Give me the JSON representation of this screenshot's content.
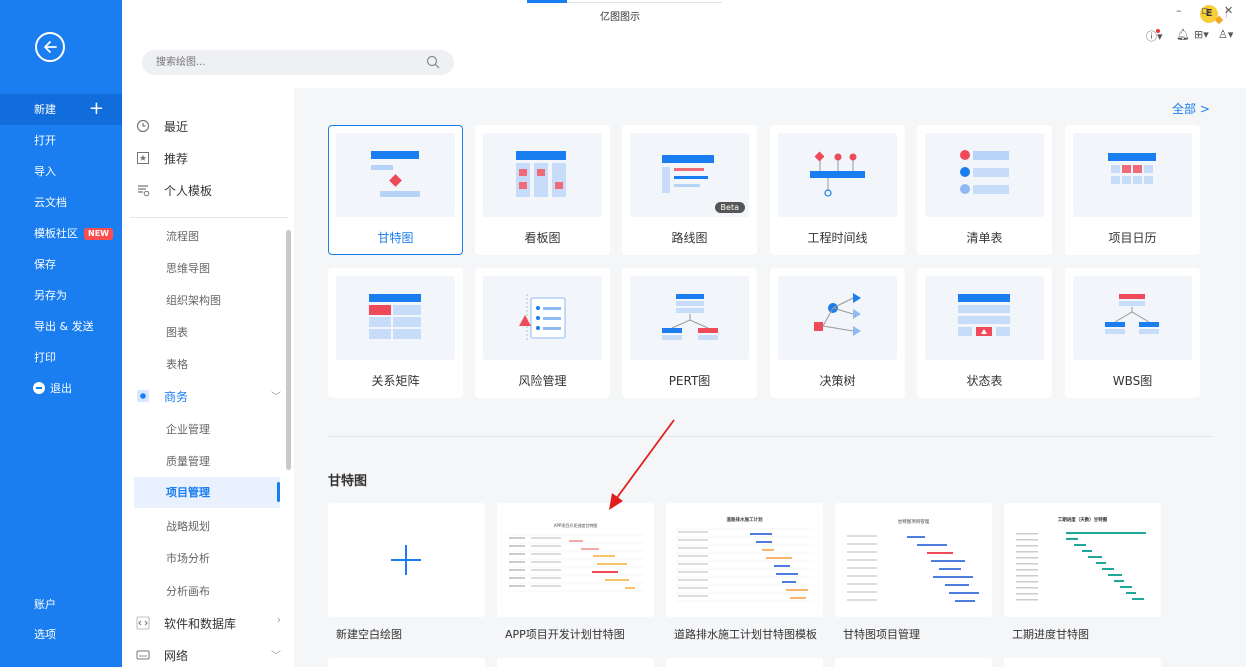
{
  "app": {
    "title": "亿图图示"
  },
  "sidebar": {
    "items": [
      {
        "label": "新建",
        "active": true,
        "has_plus": true
      },
      {
        "label": "打开"
      },
      {
        "label": "导入"
      },
      {
        "label": "云文档"
      },
      {
        "label": "模板社区",
        "badge": "NEW"
      },
      {
        "label": "保存"
      },
      {
        "label": "另存为"
      },
      {
        "label": "导出 & 发送"
      },
      {
        "label": "打印"
      },
      {
        "label": "退出",
        "icon": "exit-icon"
      }
    ],
    "bottom": [
      {
        "label": "账户"
      },
      {
        "label": "选项"
      }
    ]
  },
  "user": {
    "initial": "E"
  },
  "search": {
    "placeholder": "搜索绘图..."
  },
  "nav": {
    "top": [
      {
        "label": "最近"
      },
      {
        "label": "推荐"
      },
      {
        "label": "个人模板"
      }
    ],
    "subitems_a": [
      {
        "label": "流程图"
      },
      {
        "label": "思维导图"
      },
      {
        "label": "组织架构图"
      },
      {
        "label": "图表"
      },
      {
        "label": "表格"
      }
    ],
    "category_business": {
      "label": "商务"
    },
    "subitems_b": [
      {
        "label": "企业管理"
      },
      {
        "label": "质量管理"
      },
      {
        "label": "项目管理"
      },
      {
        "label": "战略规划"
      },
      {
        "label": "市场分析"
      },
      {
        "label": "分析画布"
      }
    ],
    "category_software": {
      "label": "软件和数据库"
    },
    "category_network": {
      "label": "网络"
    }
  },
  "main": {
    "view_all": "全部  >",
    "tiles": [
      {
        "label": "甘特图",
        "icon": "gantt-icon"
      },
      {
        "label": "看板图",
        "icon": "kanban-icon"
      },
      {
        "label": "路线图",
        "icon": "roadmap-icon",
        "badge": "Beta"
      },
      {
        "label": "工程时间线",
        "icon": "timeline-icon"
      },
      {
        "label": "清单表",
        "icon": "checklist-icon"
      },
      {
        "label": "项目日历",
        "icon": "calendar-icon"
      },
      {
        "label": "关系矩阵",
        "icon": "matrix-icon"
      },
      {
        "label": "风险管理",
        "icon": "risk-icon"
      },
      {
        "label": "PERT图",
        "icon": "pert-icon"
      },
      {
        "label": "决策树",
        "icon": "decision-tree-icon"
      },
      {
        "label": "状态表",
        "icon": "status-table-icon"
      },
      {
        "label": "WBS图",
        "icon": "wbs-icon"
      }
    ],
    "section_title": "甘特图",
    "templates": [
      {
        "label": "新建空白绘图",
        "caption": ""
      },
      {
        "label": "APP项目开发计划甘特图",
        "caption": "APP项目开发进度甘特图"
      },
      {
        "label": "道路排水施工计划甘特图模板",
        "caption": "道路排水施工计划"
      },
      {
        "label": "甘特图项目管理",
        "caption": "甘特图项目管理"
      },
      {
        "label": "工期进度甘特图",
        "caption": "工期进度（天数）甘特图"
      }
    ]
  }
}
